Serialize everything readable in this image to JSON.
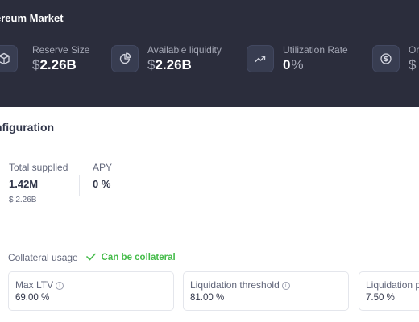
{
  "header": {
    "title": "ereum Market",
    "stats": [
      {
        "label": "Reserve Size",
        "prefix": "$",
        "value": "2.26B",
        "suffix": "",
        "icon": "cube-icon"
      },
      {
        "label": "Available liquidity",
        "prefix": "$",
        "value": "2.26B",
        "suffix": "",
        "icon": "pie-chart-icon"
      },
      {
        "label": "Utilization Rate",
        "prefix": "",
        "value": "0",
        "suffix": "%",
        "icon": "trending-up-icon"
      },
      {
        "label": "Or",
        "prefix": "$",
        "value": "",
        "suffix": "",
        "icon": "dollar-coin-icon"
      }
    ]
  },
  "config": {
    "title": "nfiguration",
    "total_supplied_label": "Total supplied",
    "total_supplied_value": "1.42M",
    "total_supplied_usd": "$ 2.26B",
    "apy_label": "APY",
    "apy_value": "0 %",
    "collateral_usage_label": "Collateral usage",
    "collateral_status": "Can be collateral",
    "cards": [
      {
        "label": "Max LTV",
        "value": "69.00 %",
        "info": "i"
      },
      {
        "label": "Liquidation threshold",
        "value": "81.00 %",
        "info": "i"
      },
      {
        "label": "Liquidation p",
        "value": "7.50 %"
      }
    ]
  },
  "colors": {
    "header_bg": "#2b2d3c",
    "success": "#46bc4b",
    "text_primary": "#303549",
    "text_secondary": "#62677b"
  }
}
